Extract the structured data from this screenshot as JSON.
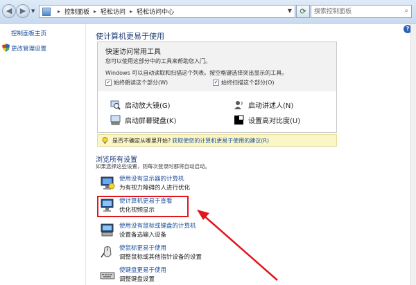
{
  "address_bar": {
    "crumbs": [
      "控制面板",
      "轻松访问",
      "轻松访问中心"
    ],
    "search_placeholder": "搜索控制面板"
  },
  "sidebar": {
    "items": [
      {
        "label": "控制面板主页"
      },
      {
        "label": "更改管理设置"
      }
    ]
  },
  "main": {
    "page_title": "使计算机更易于使用",
    "quick_access": {
      "title": "快速访问常用工具",
      "line1": "您可以使用这部分中的工具来帮助您入门。",
      "line2": "Windows 可以自动读取和扫描这个列表。按空格键选择突出显示的工具。",
      "check_read": "始终朗读这个部分(W)",
      "check_scan": "始终扫描这个部分(O)",
      "check_read_state": "✓",
      "check_scan_state": "✓"
    },
    "tools": [
      {
        "label": "启动放大镜(G)",
        "icon": "magnifier-icon"
      },
      {
        "label": "启动讲述人(N)",
        "icon": "narrator-icon"
      },
      {
        "label": "启动屏幕键盘(K)",
        "icon": "onscreen-keyboard-icon"
      },
      {
        "label": "设置高对比度(U)",
        "icon": "high-contrast-icon"
      }
    ],
    "hint": {
      "question": "是否不确定从哪里开始?",
      "link": "获取使您的计算机更易于使用的建议(R)"
    },
    "browse": {
      "title": "浏览所有设置",
      "subtitle": "如果选择这些设置，则每次登录时都将自动启动。",
      "items": [
        {
          "link": "使用没有显示器的计算机",
          "desc": "为有视力障碍的人进行优化"
        },
        {
          "link": "使计算机更易于查看",
          "desc": "优化视频显示"
        },
        {
          "link": "使用没有鼠标或键盘的计算机",
          "desc": "设置备选输入设备"
        },
        {
          "link": "使鼠标更易于使用",
          "desc": "调整鼠标或其他指针设备的设置"
        },
        {
          "link": "使键盘更易于使用",
          "desc": "调整键盘设置"
        }
      ]
    }
  },
  "colors": {
    "link": "#1a4c9b",
    "heading": "#1e3d7a",
    "highlight_red": "#e0161c",
    "hint_bg": "#fbf6c6"
  }
}
